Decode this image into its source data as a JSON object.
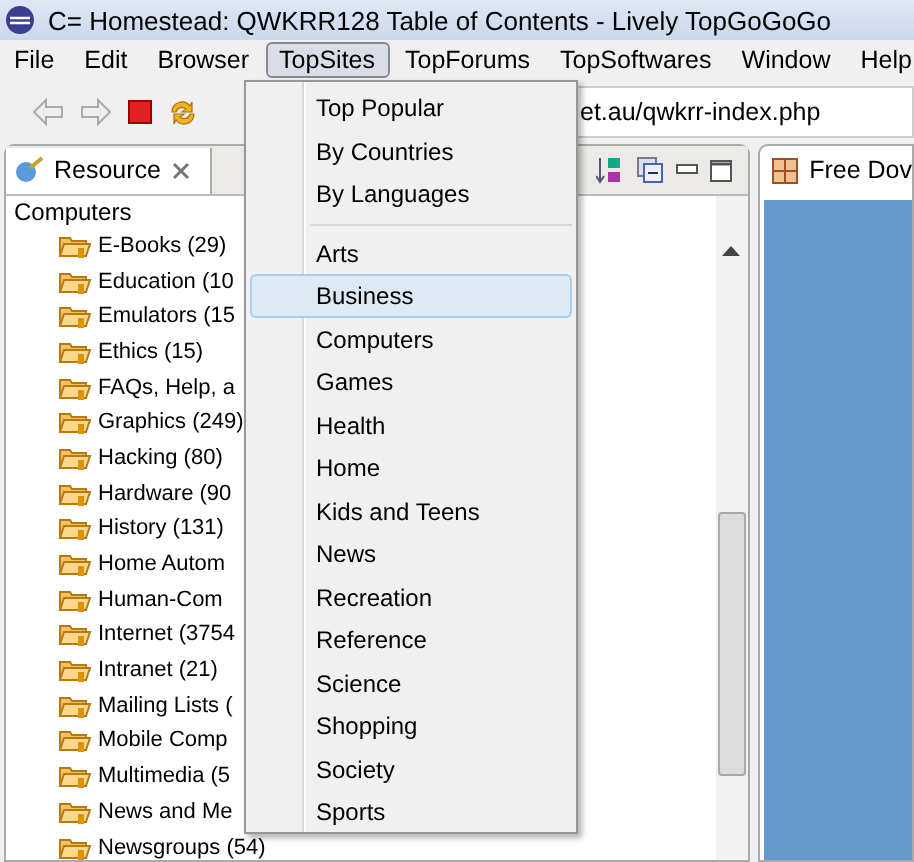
{
  "window": {
    "title": "C= Homestead: QWKRR128 Table of Contents - Lively TopGoGoGo"
  },
  "menu_bar": [
    {
      "label": "File",
      "selected": false
    },
    {
      "label": "Edit",
      "selected": false
    },
    {
      "label": "Browser",
      "selected": false
    },
    {
      "label": "TopSites",
      "selected": true
    },
    {
      "label": "TopForums",
      "selected": false
    },
    {
      "label": "TopSoftwares",
      "selected": false
    },
    {
      "label": "Window",
      "selected": false
    },
    {
      "label": "Help",
      "selected": false
    }
  ],
  "address": {
    "value": "et.au/qwkrr-index.php"
  },
  "resource_panel": {
    "tab": "Resource",
    "tree": {
      "label": "Computers",
      "children": [
        {
          "label": "E-Books (29)"
        },
        {
          "label": "Education (10"
        },
        {
          "label": "Emulators (15"
        },
        {
          "label": "Ethics (15)"
        },
        {
          "label": "FAQs, Help, a"
        },
        {
          "label": "Graphics (249)"
        },
        {
          "label": "Hacking (80)"
        },
        {
          "label": "Hardware (90"
        },
        {
          "label": "History (131)"
        },
        {
          "label": "Home Autom"
        },
        {
          "label": "Human-Com"
        },
        {
          "label": "Internet (3754"
        },
        {
          "label": "Intranet (21)"
        },
        {
          "label": "Mailing Lists ("
        },
        {
          "label": "Mobile Comp"
        },
        {
          "label": "Multimedia (5"
        },
        {
          "label": "News and Me"
        },
        {
          "label": "Newsgroups (54)"
        }
      ]
    }
  },
  "browser_panel": {
    "tab": "Free Dov"
  },
  "dropdown": {
    "groups": [
      [
        {
          "label": "Top Popular",
          "selected": false
        },
        {
          "label": "By Countries",
          "selected": false
        },
        {
          "label": "By Languages",
          "selected": false
        }
      ],
      [
        {
          "label": "Arts",
          "selected": false
        },
        {
          "label": "Business",
          "selected": true
        },
        {
          "label": "Computers",
          "selected": false
        },
        {
          "label": "Games",
          "selected": false
        },
        {
          "label": "Health",
          "selected": false
        },
        {
          "label": "Home",
          "selected": false
        },
        {
          "label": "Kids and Teens",
          "selected": false
        },
        {
          "label": "News",
          "selected": false
        },
        {
          "label": "Recreation",
          "selected": false
        },
        {
          "label": "Reference",
          "selected": false
        },
        {
          "label": "Science",
          "selected": false
        },
        {
          "label": "Shopping",
          "selected": false
        },
        {
          "label": "Society",
          "selected": false
        },
        {
          "label": "Sports",
          "selected": false
        }
      ]
    ]
  }
}
